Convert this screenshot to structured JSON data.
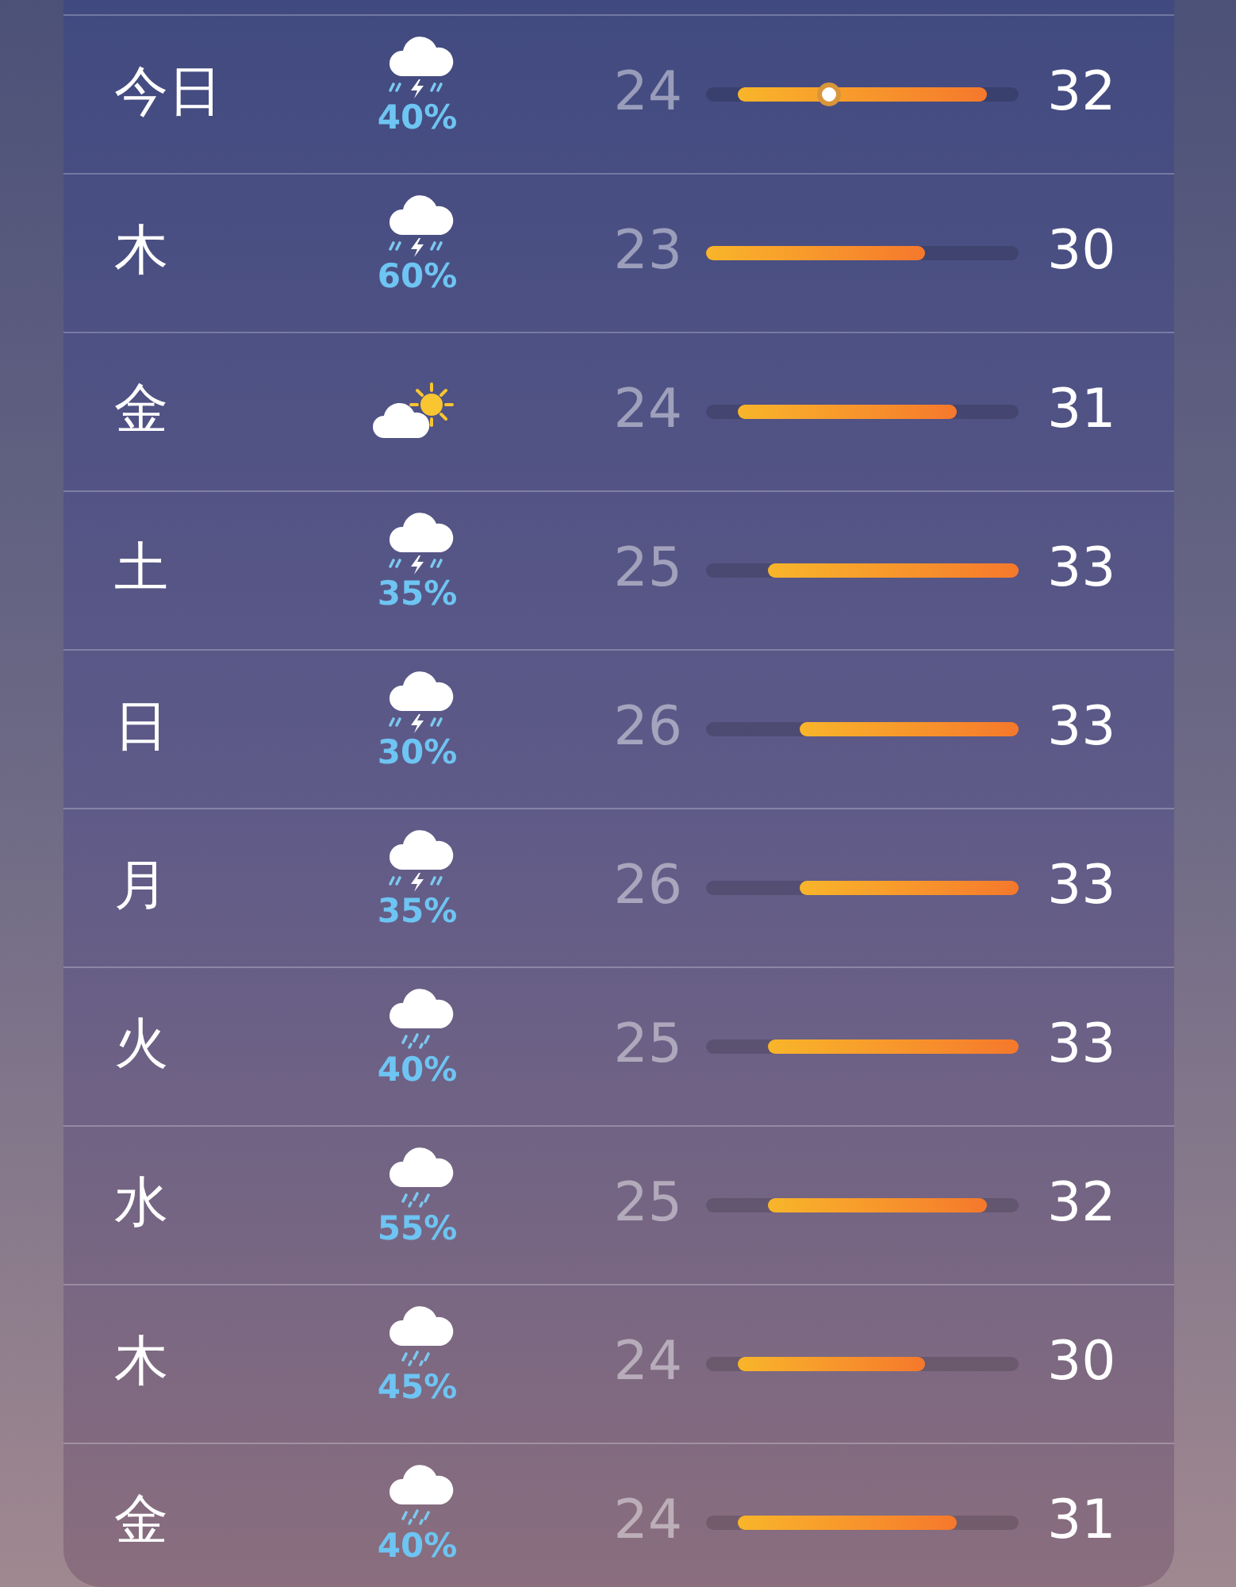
{
  "forecast": [
    {
      "day": "今日",
      "kind": "thunder-rain",
      "precip": "40%",
      "low": "24",
      "high": "32",
      "level": 0.39
    },
    {
      "day": "木",
      "kind": "thunder-rain",
      "precip": "60%",
      "low": "23",
      "high": "30"
    },
    {
      "day": "金",
      "kind": "partly-sunny",
      "low": "24",
      "high": "31"
    },
    {
      "day": "土",
      "kind": "thunder-rain",
      "precip": "35%",
      "low": "25",
      "high": "33"
    },
    {
      "day": "日",
      "kind": "thunder-rain",
      "precip": "30%",
      "low": "26",
      "high": "33"
    },
    {
      "day": "月",
      "kind": "thunder-rain",
      "precip": "35%",
      "low": "26",
      "high": "33"
    },
    {
      "day": "火",
      "kind": "rain",
      "precip": "40%",
      "low": "25",
      "high": "33"
    },
    {
      "day": "水",
      "kind": "rain",
      "precip": "55%",
      "low": "25",
      "high": "32"
    },
    {
      "day": "木",
      "kind": "rain",
      "precip": "45%",
      "low": "24",
      "high": "30"
    },
    {
      "day": "金",
      "kind": "rain",
      "precip": "40%",
      "low": "24",
      "high": "31"
    }
  ]
}
